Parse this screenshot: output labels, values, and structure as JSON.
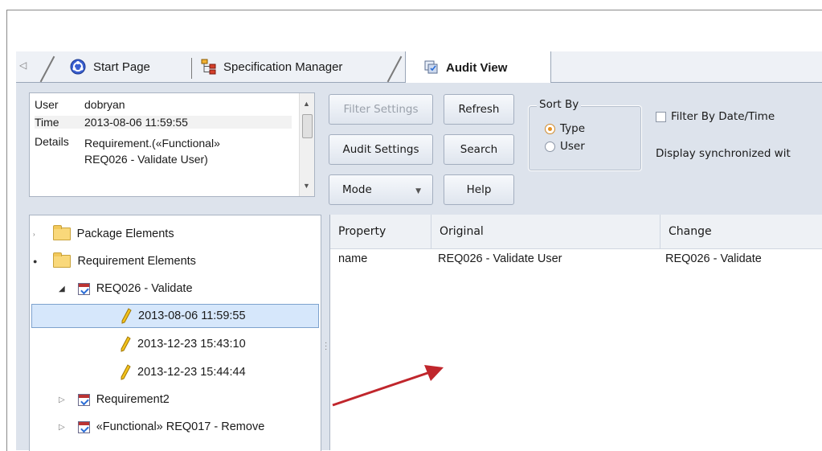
{
  "tabs": {
    "start_page": "Start Page",
    "specification_manager": "Specification Manager",
    "audit_view": "Audit View"
  },
  "details": {
    "user_key": "User",
    "user_value": "dobryan",
    "time_key": "Time",
    "time_value": "2013-08-06 11:59:55",
    "details_key": "Details",
    "details_line1": "Requirement.(«Functional»",
    "details_line2": "REQ026 - Validate User)"
  },
  "buttons": {
    "filter_settings": "Filter Settings",
    "refresh": "Refresh",
    "audit_settings": "Audit Settings",
    "search": "Search",
    "mode": "Mode",
    "help": "Help"
  },
  "sort_by": {
    "legend": "Sort By",
    "type": "Type",
    "user": "User",
    "selected": "Type"
  },
  "filter_by_date": "Filter By Date/Time",
  "sync_text": "Display synchronized wit",
  "tree": {
    "package_elements": "Package Elements",
    "requirement_elements": "Requirement Elements",
    "req026": "REQ026 - Validate",
    "ts1": "2013-08-06 11:59:55",
    "ts2": "2013-12-23 15:43:10",
    "ts3": "2013-12-23 15:44:44",
    "requirement2": "Requirement2",
    "req017": "«Functional» REQ017 - Remove"
  },
  "grid": {
    "headers": [
      "Property",
      "Original",
      "Change"
    ],
    "rows": [
      {
        "property": "name",
        "original": "REQ026 - Validate User",
        "change": "REQ026 - Validate"
      }
    ]
  },
  "colors": {
    "panel_bg": "#dde3ec",
    "selection": "#d6e7fb",
    "annotation_arrow": "#c0262c"
  }
}
